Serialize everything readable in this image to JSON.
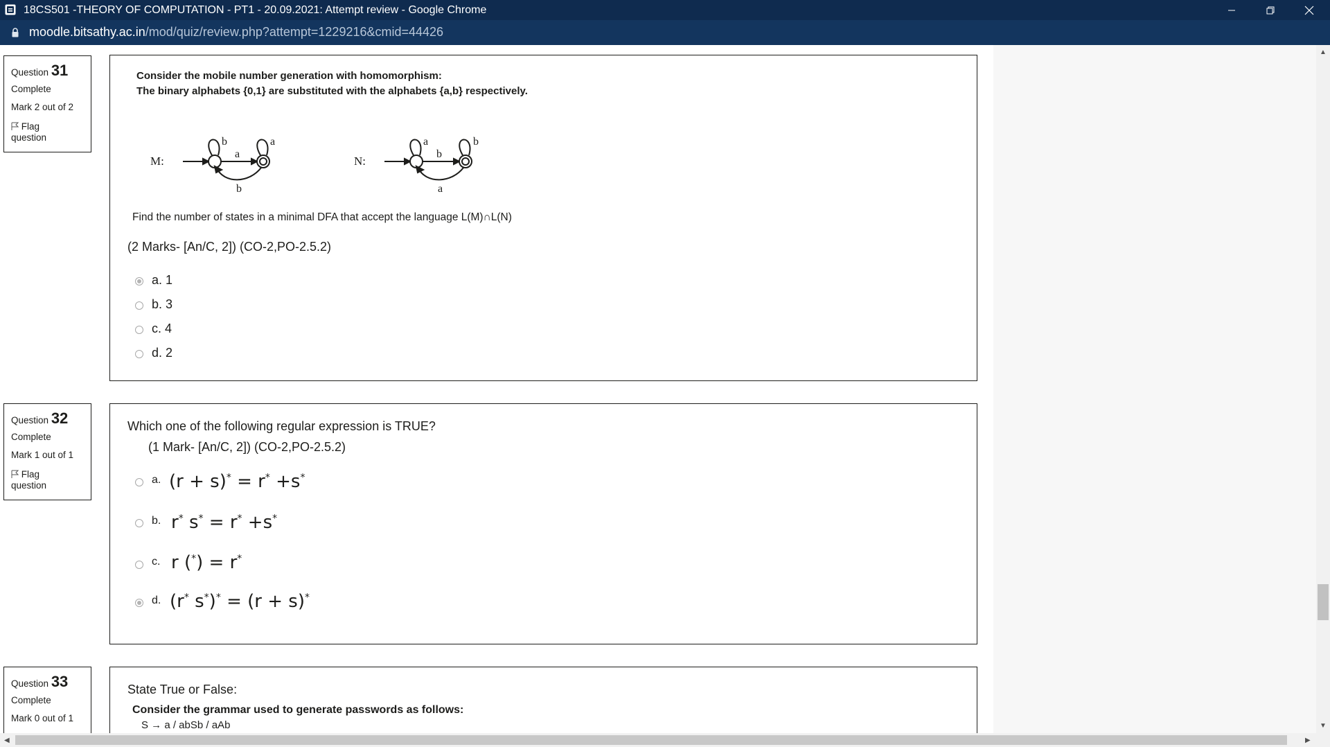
{
  "window": {
    "title": "18CS501 -THEORY OF COMPUTATION - PT1 - 20.09.2021: Attempt review - Google Chrome",
    "controls": [
      "minimize",
      "restore",
      "close"
    ]
  },
  "address_bar": {
    "host": "moodle.bitsathy.ac.in",
    "path": "/mod/quiz/review.php?attempt=1229216&cmid=44426"
  },
  "questions": [
    {
      "label": "Question",
      "number": "31",
      "state": "Complete",
      "mark": "Mark 2 out of 2",
      "flag_label_1": "Flag",
      "flag_label_2": "question",
      "intro_line1": "Consider the mobile number generation with homomorphism:",
      "intro_line2": "The binary alphabets {0,1} are substituted with the alphabets {a,b} respectively.",
      "diagram": {
        "m_label": "M:",
        "n_label": "N:",
        "m_loop1": "b",
        "m_arrow_top": "a",
        "m_loop2": "a",
        "m_arrow_bottom": "b",
        "n_loop1": "a",
        "n_arrow_top": "b",
        "n_loop2": "b",
        "n_arrow_bottom": "a"
      },
      "prompt": "Find the number of states in a minimal DFA that accept the language L(M)∩L(N)",
      "marks_note": "(2 Marks- [An/C, 2]) (CO-2,PO-2.5.2)",
      "options": [
        {
          "text": "a. 1",
          "checked": true
        },
        {
          "text": "b. 3",
          "checked": false
        },
        {
          "text": "c. 4",
          "checked": false
        },
        {
          "text": "d. 2",
          "checked": false
        }
      ]
    },
    {
      "label": "Question",
      "number": "32",
      "state": "Complete",
      "mark": "Mark 1 out of 1",
      "flag_label_1": "Flag",
      "flag_label_2": "question",
      "prompt": "Which one of the following regular expression is TRUE?",
      "marks_note": "(1 Mark- [An/C, 2]) (CO-2,PO-2.5.2)",
      "options": [
        {
          "letter": "a.",
          "checked": false
        },
        {
          "letter": "b.",
          "checked": false
        },
        {
          "letter": "c.",
          "checked": false
        },
        {
          "letter": "d.",
          "checked": true
        }
      ]
    },
    {
      "label": "Question",
      "number": "33",
      "state": "Complete",
      "mark": "Mark 0 out of 1",
      "prompt": "State True or False:",
      "line2": "Consider the grammar  used to generate passwords as follows:",
      "line3": "S → a / abSb / aAb"
    }
  ]
}
